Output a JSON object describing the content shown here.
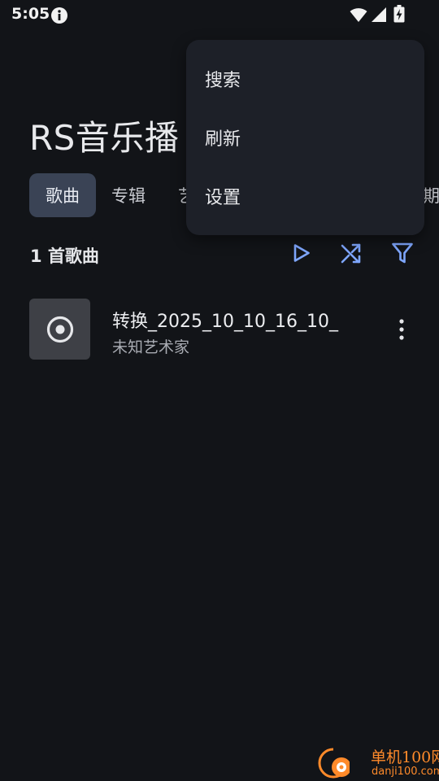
{
  "status_bar": {
    "time": "5:05",
    "icons": [
      "info-icon",
      "wifi-icon",
      "signal-icon",
      "battery-charging-icon"
    ]
  },
  "app": {
    "title": "RS音乐播"
  },
  "tabs": [
    {
      "label": "歌曲",
      "active": true
    },
    {
      "label": "专辑",
      "active": false
    },
    {
      "label": "艺",
      "active": false
    },
    {
      "label": "期",
      "active": false
    }
  ],
  "list_header": {
    "count_label": "1 首歌曲",
    "actions": [
      "play-icon",
      "shuffle-icon",
      "filter-icon"
    ]
  },
  "songs": [
    {
      "title": "转换_2025_10_10_16_10_",
      "artist": "未知艺术家",
      "icon": "disc-icon"
    }
  ],
  "menu": {
    "items": [
      {
        "label": "搜索"
      },
      {
        "label": "刷新"
      },
      {
        "label": "设置"
      }
    ]
  },
  "watermark": {
    "main": "单机100网",
    "sub": "danji100.com"
  },
  "colors": {
    "background": "#121418",
    "accent": "#7fa7ff",
    "tab_active_bg": "#3a4355",
    "menu_bg": "#1d2028",
    "watermark": "#ff8a2a"
  }
}
